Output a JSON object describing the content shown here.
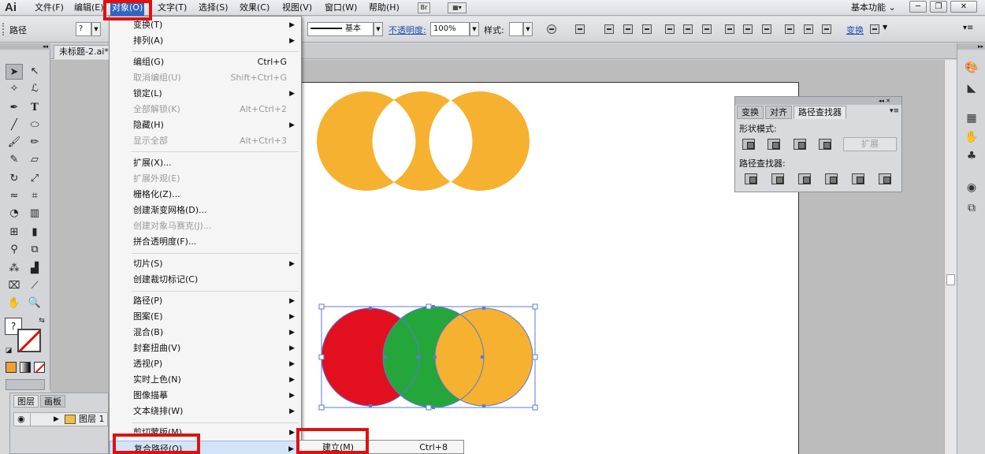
{
  "app": {
    "logo": "Ai",
    "workspace": "基本功能 ⌄"
  },
  "menubar": {
    "items": [
      "文件(F)",
      "编辑(E)",
      "对象(O)",
      "文字(T)",
      "选择(S)",
      "效果(C)",
      "视图(V)",
      "窗口(W)",
      "帮助(H)"
    ],
    "icons": [
      "Br"
    ]
  },
  "controlbar": {
    "selection_label": "路径",
    "stroke_profile": "基本",
    "opacity_label": "不透明度:",
    "opacity_value": "100%",
    "style_label": "样式:",
    "transform_label": "变换"
  },
  "document": {
    "tab_title": "未标题-2.ai*"
  },
  "object_menu": {
    "items": [
      {
        "label": "变换(T)",
        "submenu": true
      },
      {
        "label": "排列(A)",
        "submenu": true
      },
      {
        "label": "编组(G)",
        "shortcut": "Ctrl+G"
      },
      {
        "label": "取消编组(U)",
        "shortcut": "Shift+Ctrl+G",
        "disabled": true
      },
      {
        "label": "锁定(L)",
        "submenu": true
      },
      {
        "label": "全部解锁(K)",
        "shortcut": "Alt+Ctrl+2",
        "disabled": true
      },
      {
        "label": "隐藏(H)",
        "submenu": true
      },
      {
        "label": "显示全部",
        "shortcut": "Alt+Ctrl+3",
        "disabled": true
      },
      {
        "label": "扩展(X)..."
      },
      {
        "label": "扩展外观(E)",
        "disabled": true
      },
      {
        "label": "栅格化(Z)..."
      },
      {
        "label": "创建渐变网格(D)..."
      },
      {
        "label": "创建对象马赛克(J)...",
        "disabled": true
      },
      {
        "label": "拼合透明度(F)..."
      },
      {
        "label": "切片(S)",
        "submenu": true
      },
      {
        "label": "创建裁切标记(C)"
      },
      {
        "label": "路径(P)",
        "submenu": true
      },
      {
        "label": "图案(E)",
        "submenu": true
      },
      {
        "label": "混合(B)",
        "submenu": true
      },
      {
        "label": "封套扭曲(V)",
        "submenu": true
      },
      {
        "label": "透视(P)",
        "submenu": true
      },
      {
        "label": "实时上色(N)",
        "submenu": true
      },
      {
        "label": "图像描摹",
        "submenu": true
      },
      {
        "label": "文本绕排(W)",
        "submenu": true
      },
      {
        "label": "剪切蒙版(M)",
        "submenu": true
      },
      {
        "label": "复合路径(O)",
        "submenu": true
      }
    ]
  },
  "submenu": {
    "label": "建立(M)",
    "shortcut": "Ctrl+8"
  },
  "pathfinder": {
    "tabs": [
      "变换",
      "对齐",
      "路径查找器"
    ],
    "shape_modes_label": "形状模式:",
    "pathfinders_label": "路径查找器:",
    "expand_label": "扩展"
  },
  "layers": {
    "tabs": [
      "图层",
      "画板"
    ],
    "layer_name": "图层 1"
  },
  "colors": {
    "orange": "#f5b12f",
    "red": "#e2101e",
    "green": "#24a63a",
    "highlight": "#e01010"
  }
}
